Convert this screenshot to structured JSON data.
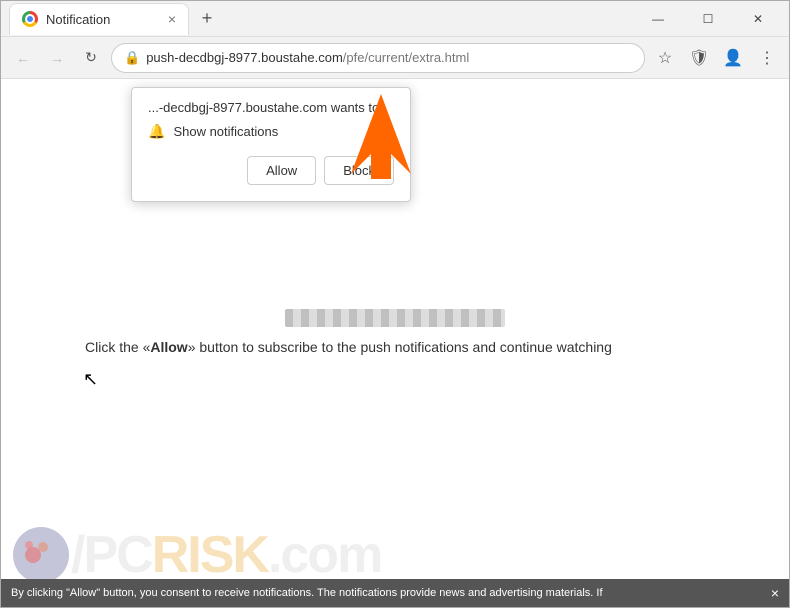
{
  "browser": {
    "tab": {
      "title": "Notification",
      "close_btn": "×"
    },
    "new_tab_btn": "+",
    "window_controls": {
      "minimize": "—",
      "maximize": "☐",
      "close": "✕"
    },
    "address_bar": {
      "url_domain": "push-decdbgj-8977.boustahe.com",
      "url_path": "/pfe/current/extra.html",
      "back_btn": "←",
      "forward_btn": "→",
      "reload_btn": "↻"
    }
  },
  "notification_popup": {
    "title_text": "...-decdbgj-8977.boustahe.com wants to",
    "notification_label": "Show notifications",
    "allow_btn": "Allow",
    "block_btn": "Block"
  },
  "page": {
    "loading_bar_alt": "loading bar",
    "main_text": "Click the «Allow» button to subscribe to the push notifications and continue watching"
  },
  "bottom_bar": {
    "text": "By clicking \"Allow\" button, you consent to receive notifications. The notifications provide news and advertising materials. If",
    "close_btn": "×"
  },
  "logo": {
    "slash": "/",
    "pc_text": "PC",
    "risk_text": "RISK",
    "dot": ".",
    "com": "com"
  }
}
